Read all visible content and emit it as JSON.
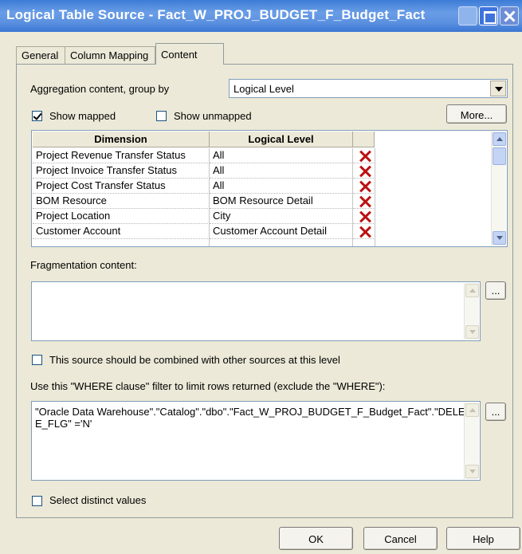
{
  "window": {
    "title": "Logical Table Source - Fact_W_PROJ_BUDGET_F_Budget_Fact"
  },
  "tabs": [
    {
      "label": "General"
    },
    {
      "label": "Column Mapping"
    },
    {
      "label": "Content"
    }
  ],
  "content": {
    "aggregation_label": "Aggregation content, group by",
    "aggregation_value": "Logical Level",
    "show_mapped_label": "Show mapped",
    "show_unmapped_label": "Show unmapped",
    "more_button": "More...",
    "grid": {
      "headers": [
        "Dimension",
        "Logical Level"
      ],
      "rows": [
        {
          "dimension": "Project Revenue Transfer Status",
          "level": "All"
        },
        {
          "dimension": "Project Invoice Transfer Status",
          "level": "All"
        },
        {
          "dimension": "Project Cost Transfer Status",
          "level": "All"
        },
        {
          "dimension": "BOM Resource",
          "level": "BOM Resource Detail"
        },
        {
          "dimension": "Project Location",
          "level": "City"
        },
        {
          "dimension": "Customer Account",
          "level": "Customer Account Detail"
        }
      ]
    },
    "fragmentation_label": "Fragmentation content:",
    "combine_label": "This source should be combined with other sources at this level",
    "where_label": "Use this \"WHERE clause\" filter to limit rows returned (exclude the \"WHERE\"):",
    "where_value": "\"Oracle Data Warehouse\".\"Catalog\".\"dbo\".\"Fact_W_PROJ_BUDGET_F_Budget_Fact\".\"DELETE_FLG\" ='N'",
    "browse_button": "...",
    "distinct_label": "Select distinct values"
  },
  "buttons": {
    "ok": "OK",
    "cancel": "Cancel",
    "help": "Help"
  }
}
